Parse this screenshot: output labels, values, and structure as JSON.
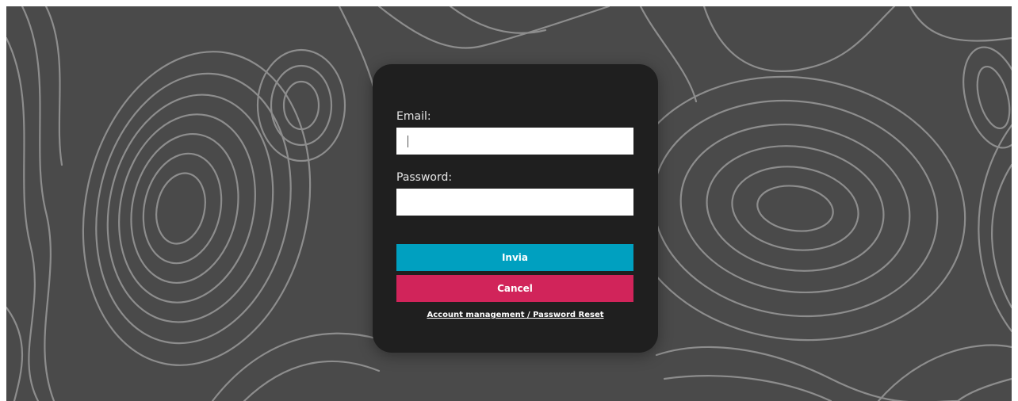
{
  "login": {
    "email_label": "Email:",
    "email_value": "",
    "password_label": "Password:",
    "password_value": "",
    "submit_label": "Invia",
    "cancel_label": "Cancel",
    "account_link_label": "Account management / Password Reset"
  },
  "colors": {
    "background": "#4a4a4a",
    "contour_lines": "#9a9a9a",
    "card": "#1f1f1f",
    "submit_button": "#00a0c0",
    "cancel_button": "#d1245a"
  },
  "icons": {
    "background": "topographic-contour-pattern"
  }
}
